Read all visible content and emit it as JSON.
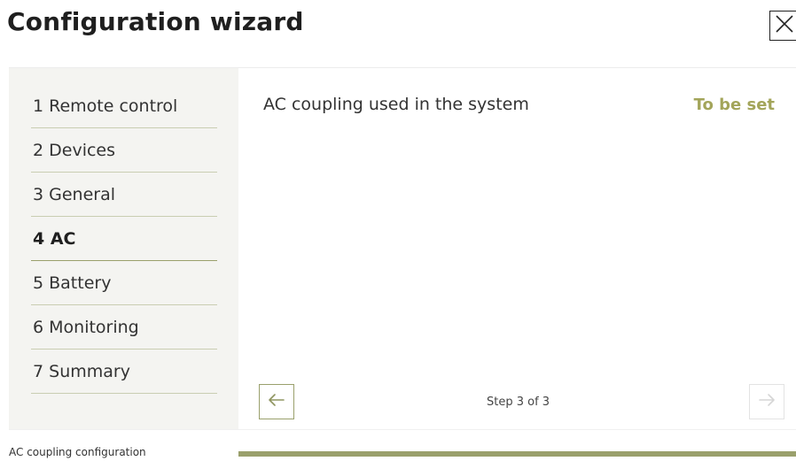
{
  "header": {
    "title": "Configuration wizard",
    "close_icon": "close-icon"
  },
  "sidebar": {
    "items": [
      {
        "label": "1 Remote control",
        "active": false
      },
      {
        "label": "2 Devices",
        "active": false
      },
      {
        "label": "3 General",
        "active": false
      },
      {
        "label": "4 AC",
        "active": true
      },
      {
        "label": "5 Battery",
        "active": false
      },
      {
        "label": "6 Monitoring",
        "active": false
      },
      {
        "label": "7 Summary",
        "active": false
      }
    ]
  },
  "main": {
    "setting": {
      "label": "AC coupling used in the system",
      "status": "To be set"
    },
    "nav": {
      "prev_icon": "arrow-left-icon",
      "next_icon": "arrow-right-icon",
      "step_text": "Step 3 of 3"
    }
  },
  "footer": {
    "caption": "AC coupling configuration",
    "progress": 1.0
  },
  "colors": {
    "accent": "#9aa06c",
    "status": "#a3a55a",
    "sidebar_bg": "#f4f4f1"
  }
}
